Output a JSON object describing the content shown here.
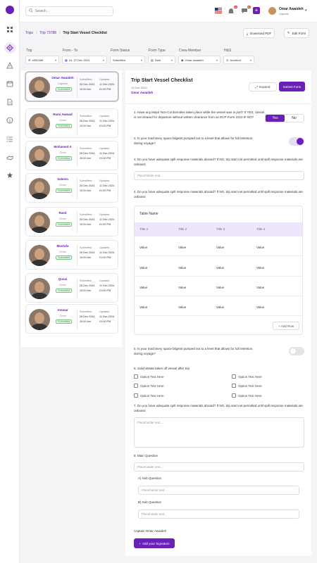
{
  "app": {
    "brand_color": "#6a1fb8"
  },
  "sidebar": {
    "icons": [
      "grid-icon",
      "ship-wheel-icon",
      "alert-icon",
      "calendar-icon",
      "document-icon",
      "info-icon",
      "list-icon",
      "handshake-icon",
      "star-icon"
    ]
  },
  "topbar": {
    "search_placeholder": "Search...",
    "flag_badge": "",
    "notif_badge": "99",
    "chat_badge": "99",
    "user_name": "Omar Awaideh",
    "user_role": "Captain"
  },
  "breadcrumb": {
    "items": [
      "Trips",
      "Trip 73788",
      "Trip Start Vessel Checklist"
    ]
  },
  "actions": {
    "download": "Download PDF",
    "edit": "Edit Form"
  },
  "filters": {
    "labels": [
      "Trip",
      "From - To",
      "Form Status",
      "Form Type",
      "Crew Member",
      "H&S"
    ],
    "values": [
      "#392486",
      "24- 27 Dec 2024",
      "Submitted",
      "Start",
      "Omar Awaideh",
      "Accident"
    ]
  },
  "crew": [
    {
      "name": "Omar Awaideh",
      "role": "Captain",
      "status": "Submitted",
      "submitted_label": "Submitted",
      "submitted_date": "26 Dec 2024",
      "submitted_time": "10:00 Am",
      "updated_label": "Updated",
      "updated_date": "11 Dec 2024",
      "updated_time": "01:00 PM"
    },
    {
      "name": "Rami Awwad",
      "role": "Crew",
      "status": "Submitted",
      "submitted_label": "Submitted",
      "submitted_date": "26 Dec 2024",
      "submitted_time": "10:00 Am",
      "updated_label": "Updated",
      "updated_date": "11 Dec 2024",
      "updated_time": "01:00 PM"
    },
    {
      "name": "Mohamed A",
      "role": "Crew",
      "status": "Submitted",
      "submitted_label": "Submitted",
      "submitted_date": "26 Dec 2024",
      "submitted_time": "10:00 Am",
      "updated_label": "Updated",
      "updated_date": "11 Dec 2024",
      "updated_time": "01:00 PM"
    },
    {
      "name": "Saleem",
      "role": "Crew",
      "status": "Submitted",
      "submitted_label": "Submitted",
      "submitted_date": "26 Dec 2024",
      "submitted_time": "10:00 Am",
      "updated_label": "Updated",
      "updated_date": "11 Dec 2024",
      "updated_time": "01:00 PM"
    },
    {
      "name": "Raed",
      "role": "Crew",
      "status": "Submitted",
      "submitted_label": "Submitted",
      "submitted_date": "26 Dec 2024",
      "submitted_time": "10:00 Am",
      "updated_label": "Updated",
      "updated_date": "11 Dec 2024",
      "updated_time": "01:00 PM"
    },
    {
      "name": "Mustafa",
      "role": "Crew",
      "status": "Submitted",
      "submitted_label": "Submitted",
      "submitted_date": "26 Dec 2024",
      "submitted_time": "10:00 Am",
      "updated_label": "Updated",
      "updated_date": "11 Dec 2024",
      "updated_time": "01:00 PM"
    },
    {
      "name": "Qusai",
      "role": "Crew",
      "status": "Submitted",
      "submitted_label": "Submitted",
      "submitted_date": "26 Dec 2024",
      "submitted_time": "10:00 Am",
      "updated_label": "Updated",
      "updated_date": "11 Dec 2024",
      "updated_time": "01:00 PM"
    },
    {
      "name": "Ammar",
      "role": "Crew",
      "status": "Submitted",
      "submitted_label": "Submitted",
      "submitted_date": "26 Dec 2024",
      "submitted_time": "10:00 Am",
      "updated_label": "Updated",
      "updated_date": "11 Dec 2024",
      "updated_time": "01:00 PM"
    }
  ],
  "form": {
    "title": "Trip Start Vessel Checklist",
    "date": "12 Dec 2024",
    "user": "Omar Awaideh",
    "expand": "Expand",
    "submit": "Submit Form",
    "q1": "1.  Have any Major Non-Conformities taken place while the vessel was in port? If YES, Vessel is not cleared for departure without written clearance from an ECP Form 2210 IF NO?",
    "yes": "Yes",
    "no": "No",
    "q2": "2.  Is your machinery space bilgetst pumped out to a level that allows for full retention during voyage?",
    "q2_toggle": true,
    "q3": "3. Do you have adequate spill response materials aboard? If NO, trip start not permitted until spill response materials are onboard",
    "q3_placeholder": "Placeholder text...",
    "q4": "4. Do you have adequate spill response materials aboard? If NO, trip start not permitted until spill response materials are onboard",
    "table": {
      "name": "Table Name",
      "headers": [
        "Title 1",
        "Title 2",
        "Title 3",
        "Title 4"
      ],
      "rows": [
        [
          "Value",
          "Value",
          "Value",
          "Value"
        ],
        [
          "Value",
          "Value",
          "Value",
          "Value"
        ],
        [
          "Value",
          "Value",
          "Value",
          "Value"
        ],
        [
          "Value",
          "Value",
          "Value",
          "Value"
        ]
      ],
      "add_row": "Add Row"
    },
    "q5": "5.  Is your machinery space bilgetst pumped out to a level that allows for full retention during voyage?",
    "q5_toggle": false,
    "q6": "6. Solid Waste taken off vessel after trip",
    "options": [
      "Option Text Here",
      "Option Text Here",
      "Option Text Here",
      "Option Text Here",
      "Option Text Here",
      "Option Text Here"
    ],
    "q7": "7.  Do you have adequate spill response materials aboard? If NO, trip start not permitted until spill response materials are onboard",
    "q7_placeholder": "Placeholder text...",
    "q8": "8. Main Question",
    "q8_placeholder": "Placeholder text...",
    "sub_a": "A) Sub Question",
    "sub_a_placeholder": "Placeholder text...",
    "sub_b": "B) Sub Question",
    "sub_b_placeholder": "Placeholder text...",
    "signer": "Captain Omar Awaideh",
    "signature_btn": "Add your Signature"
  }
}
